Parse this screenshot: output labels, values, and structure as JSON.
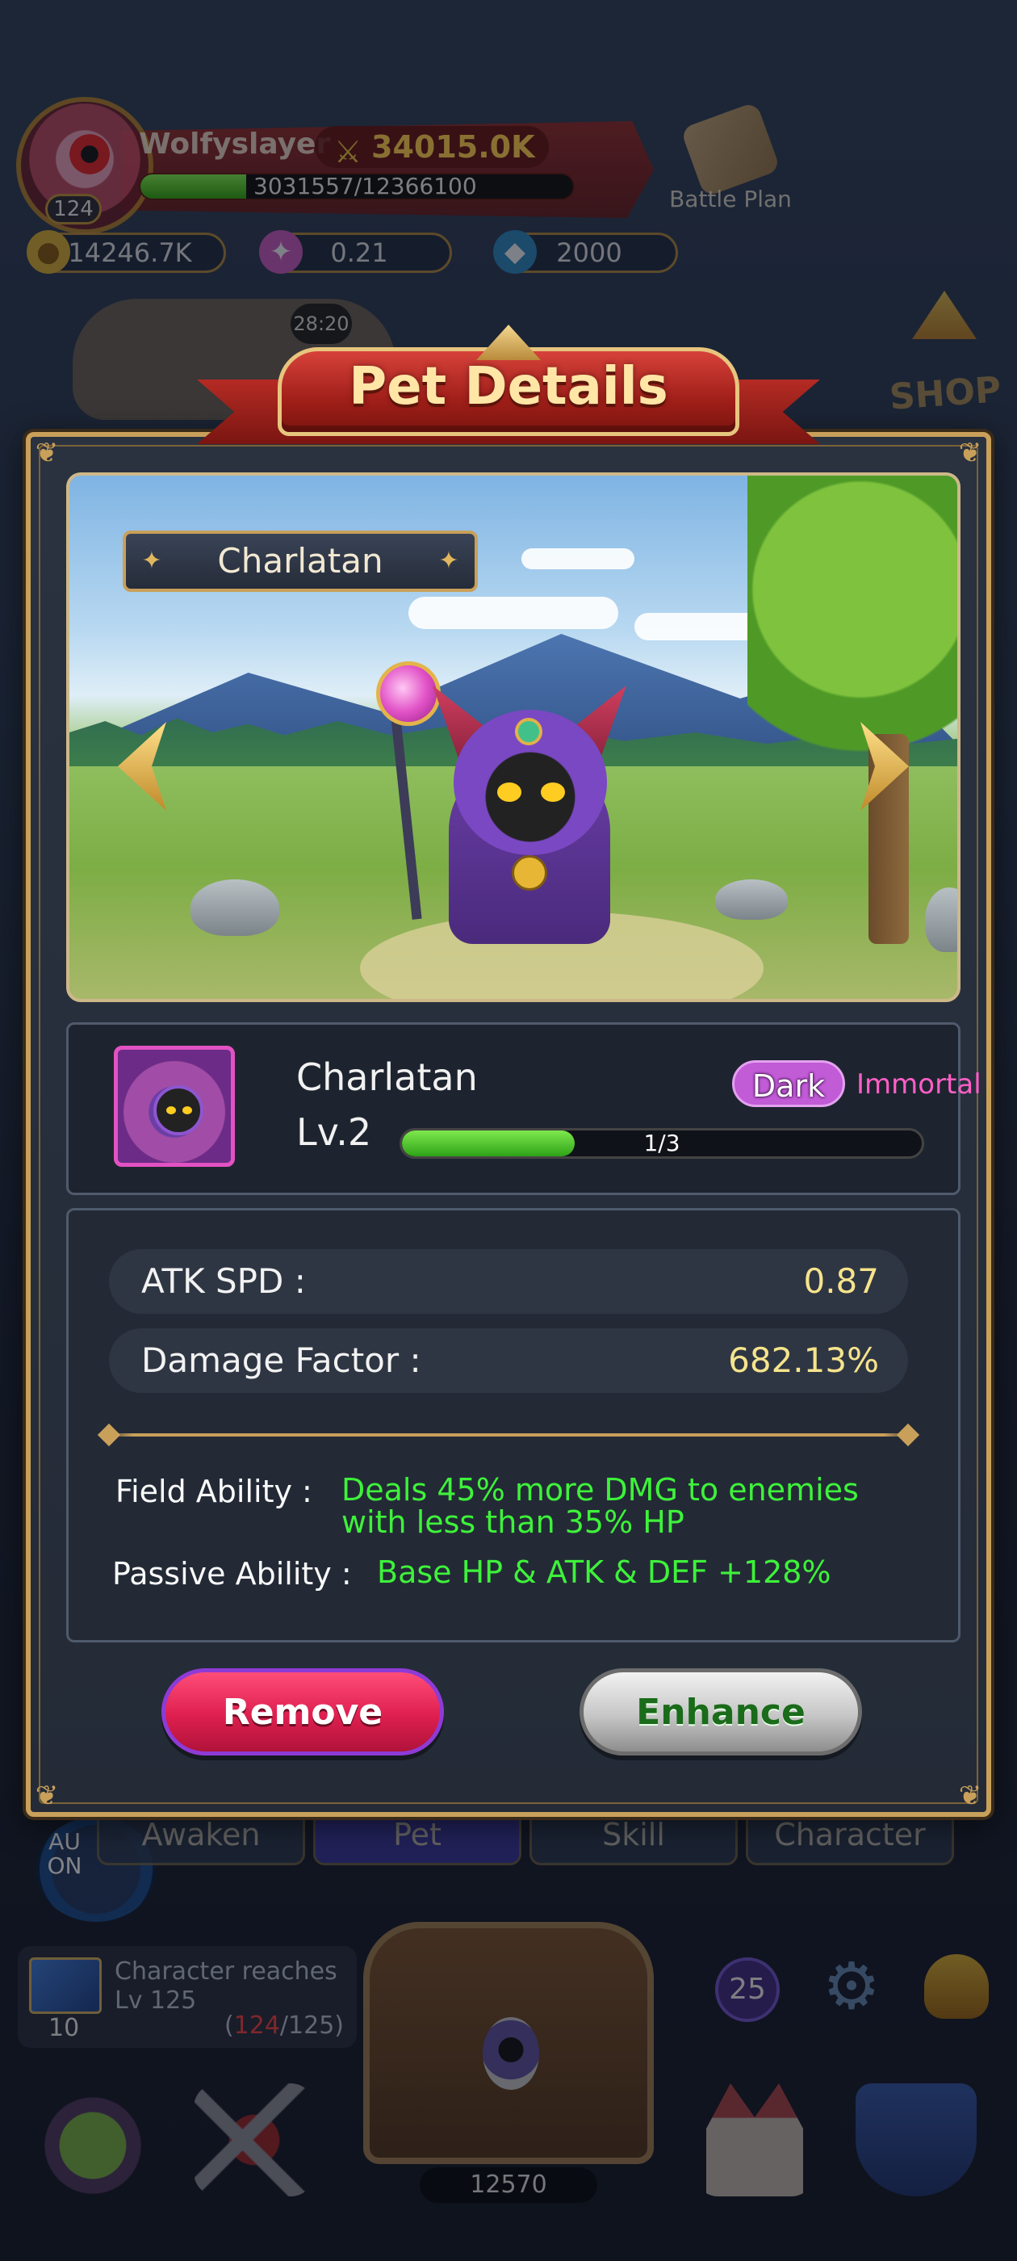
{
  "player": {
    "name": "Wolfyslayer",
    "level": "124",
    "power": "34015.0K",
    "xp_text": "3031557/12366100",
    "xp_fraction": 0.245
  },
  "battle_plan": {
    "label": "Battle Plan"
  },
  "resources": [
    {
      "icon": "coin-icon",
      "value": "14246.7K"
    },
    {
      "icon": "crystal-icon",
      "value": "0.21"
    },
    {
      "icon": "gem-icon",
      "value": "2000"
    }
  ],
  "background": {
    "timer": "28:20",
    "shop_label": "SHOP",
    "tabs": [
      {
        "label": "Awaken"
      },
      {
        "label": "Pet"
      },
      {
        "label": "Skill"
      },
      {
        "label": "Character"
      }
    ],
    "auto_label": "AU ON",
    "quest": {
      "flag_count": "10",
      "text_line1": "Character reaches",
      "text_line2": "Lv 125",
      "progress_current": "124",
      "progress_total": "/125)",
      "progress_open": "("
    },
    "badge_count": "25",
    "key_count": "12570"
  },
  "modal": {
    "title": "Pet Details",
    "name_plate": "Charlatan",
    "pet": {
      "name": "Charlatan",
      "level": "Lv.2",
      "element": "Dark",
      "rarity": "Immortal",
      "progress_text": "1/3",
      "progress_fraction": 0.333
    },
    "stats": [
      {
        "label": "ATK SPD :",
        "value": "0.87"
      },
      {
        "label": "Damage Factor :",
        "value": "682.13%"
      }
    ],
    "abilities": {
      "field_label": "Field Ability :",
      "field_text": "Deals 45% more DMG to enemies with less than 35% HP",
      "passive_label": "Passive Ability :",
      "passive_text": "Base HP & ATK & DEF +128%"
    },
    "buttons": {
      "remove": "Remove",
      "enhance": "Enhance"
    }
  },
  "colors": {
    "accent_gold": "#c9a05a",
    "ability_green": "#3ef23a",
    "stat_value": "#f6e48c",
    "rarity_pink": "#ff5fc7",
    "remove_red": "#de1f4f"
  }
}
